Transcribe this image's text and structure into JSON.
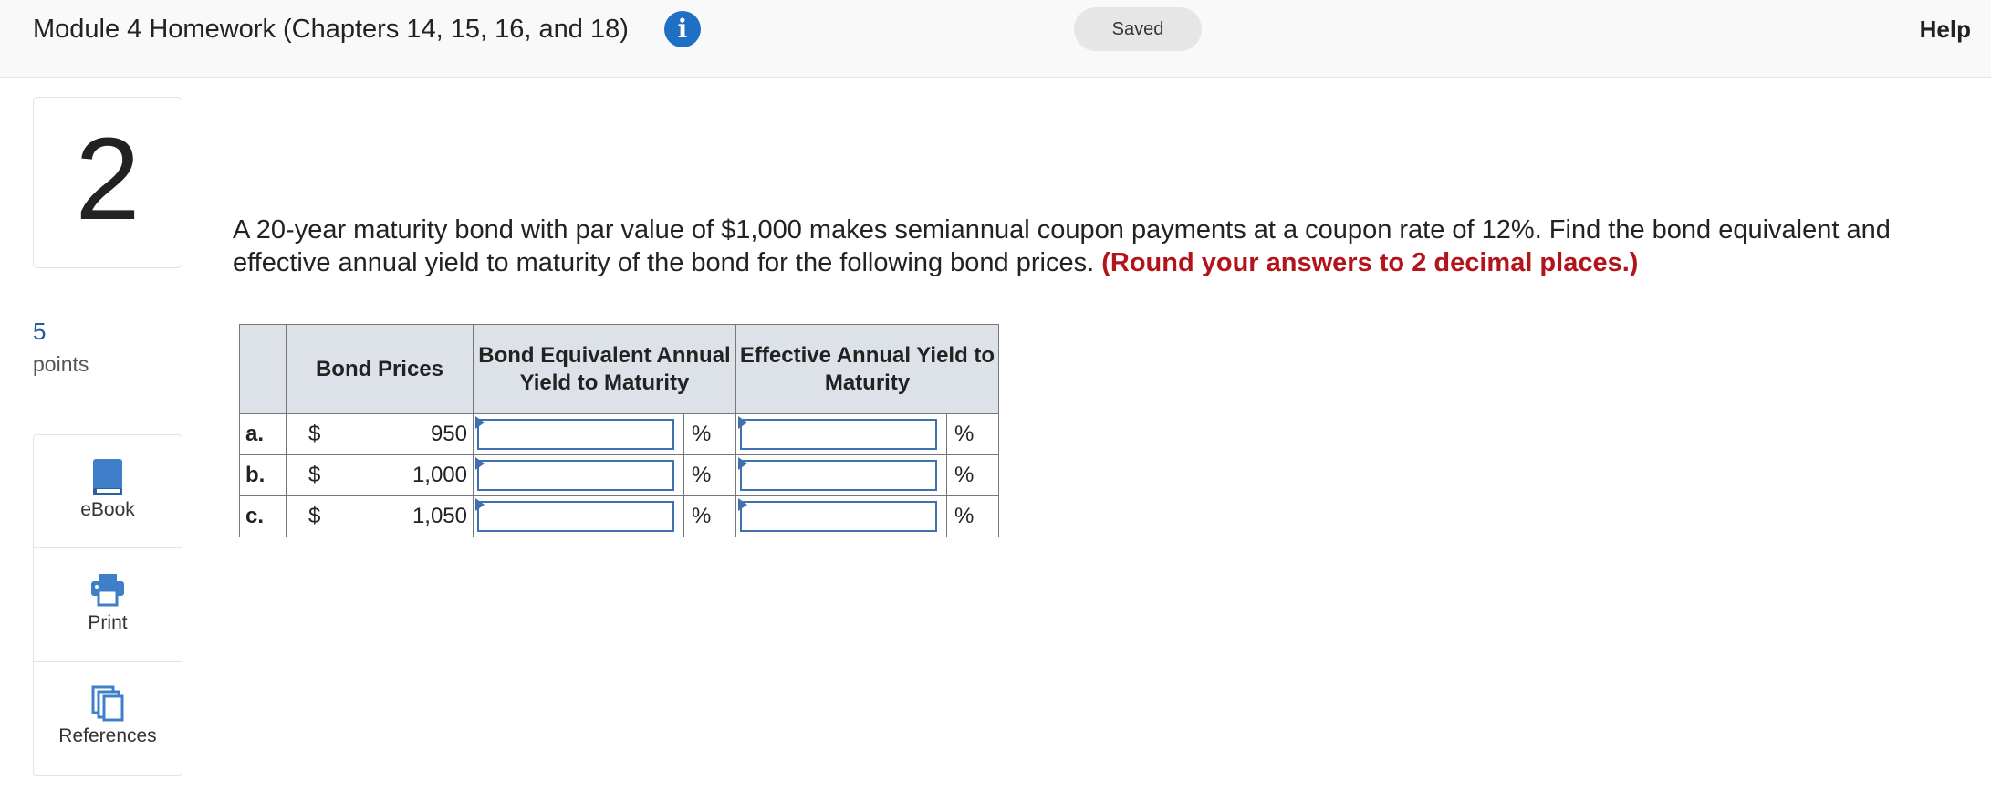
{
  "header": {
    "title": "Module 4 Homework (Chapters 14, 15, 16, and 18)",
    "status": "Saved",
    "help_label": "Help"
  },
  "question": {
    "number": "2",
    "points_value": "5",
    "points_label": "points",
    "text": "A 20-year maturity bond with par value of $1,000 makes semiannual coupon payments at a coupon rate of 12%. Find the bond equivalent and effective annual yield to maturity of the bond for the following bond prices.",
    "note": "(Round your answers to 2 decimal places.)"
  },
  "tools": [
    {
      "label": "eBook",
      "icon": "book-icon"
    },
    {
      "label": "Print",
      "icon": "printer-icon"
    },
    {
      "label": "References",
      "icon": "references-icon"
    }
  ],
  "table": {
    "headers": [
      "Bond Prices",
      "Bond Equivalent Annual Yield to Maturity",
      "Effective Annual Yield to Maturity"
    ],
    "rows": [
      {
        "label": "a.",
        "currency": "$",
        "price": "950",
        "bey": "",
        "eay": "",
        "unit": "%"
      },
      {
        "label": "b.",
        "currency": "$",
        "price": "1,000",
        "bey": "",
        "eay": "",
        "unit": "%"
      },
      {
        "label": "c.",
        "currency": "$",
        "price": "1,050",
        "bey": "",
        "eay": "",
        "unit": "%"
      }
    ]
  },
  "colors": {
    "accent": "#1f6fc5",
    "note_red": "#b3141b",
    "input_border": "#3f71b1",
    "header_bg": "#dde1e8"
  }
}
